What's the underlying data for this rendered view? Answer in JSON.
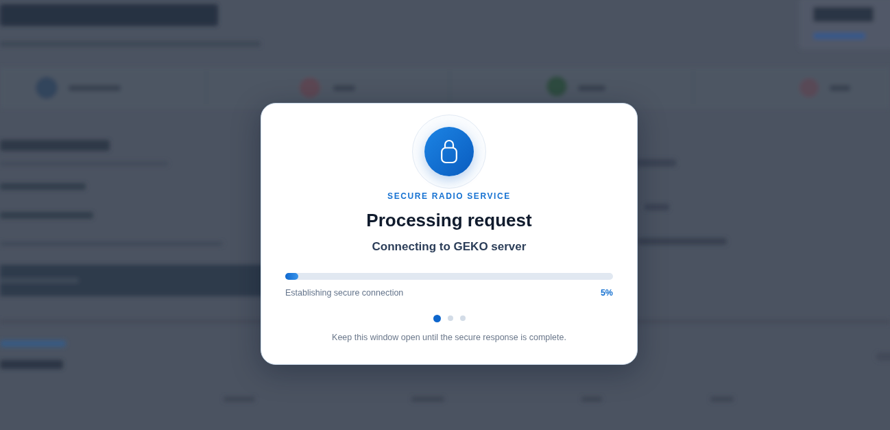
{
  "dialog": {
    "eyebrow": "SECURE RADIO SERVICE",
    "title": "Processing request",
    "subtitle": "Connecting to GEKO server",
    "progress": {
      "label": "Establishing secure connection",
      "level": 0.04,
      "reading": "5%"
    },
    "steps": [
      {
        "selected": true
      },
      {
        "selected": false
      },
      {
        "selected": false
      }
    ],
    "note": "Keep this window open until the secure response is complete."
  }
}
